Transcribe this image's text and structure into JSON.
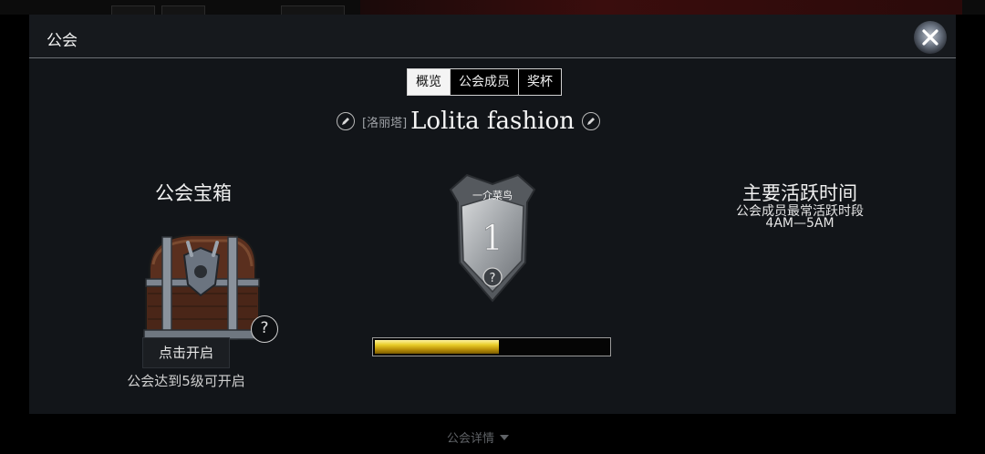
{
  "window": {
    "title": "公会"
  },
  "tabs": [
    {
      "label": "概览",
      "active": true
    },
    {
      "label": "公会成员",
      "active": false
    },
    {
      "label": "奖杯",
      "active": false
    }
  ],
  "guild": {
    "tag": "[洛丽塔]",
    "name": "Lolita fashion"
  },
  "chest": {
    "title": "公会宝箱",
    "open_label": "点击开启",
    "note": "公会达到5级可开启",
    "help": "?"
  },
  "rank": {
    "title": "一介菜鸟",
    "level": "1",
    "help": "?",
    "progress": 0.53
  },
  "activity": {
    "title": "主要活跃时间",
    "subtitle": "公会成员最常活跃时段",
    "time": "4AM—5AM"
  },
  "footer": {
    "details_label": "公会详情"
  },
  "colors": {
    "progress_fill": "#e9cd29",
    "accent": "#f4f4f4"
  },
  "icons": {
    "close": "close-icon",
    "edit": "pencil-icon",
    "help": "question-icon",
    "expand": "caret-down-icon"
  }
}
